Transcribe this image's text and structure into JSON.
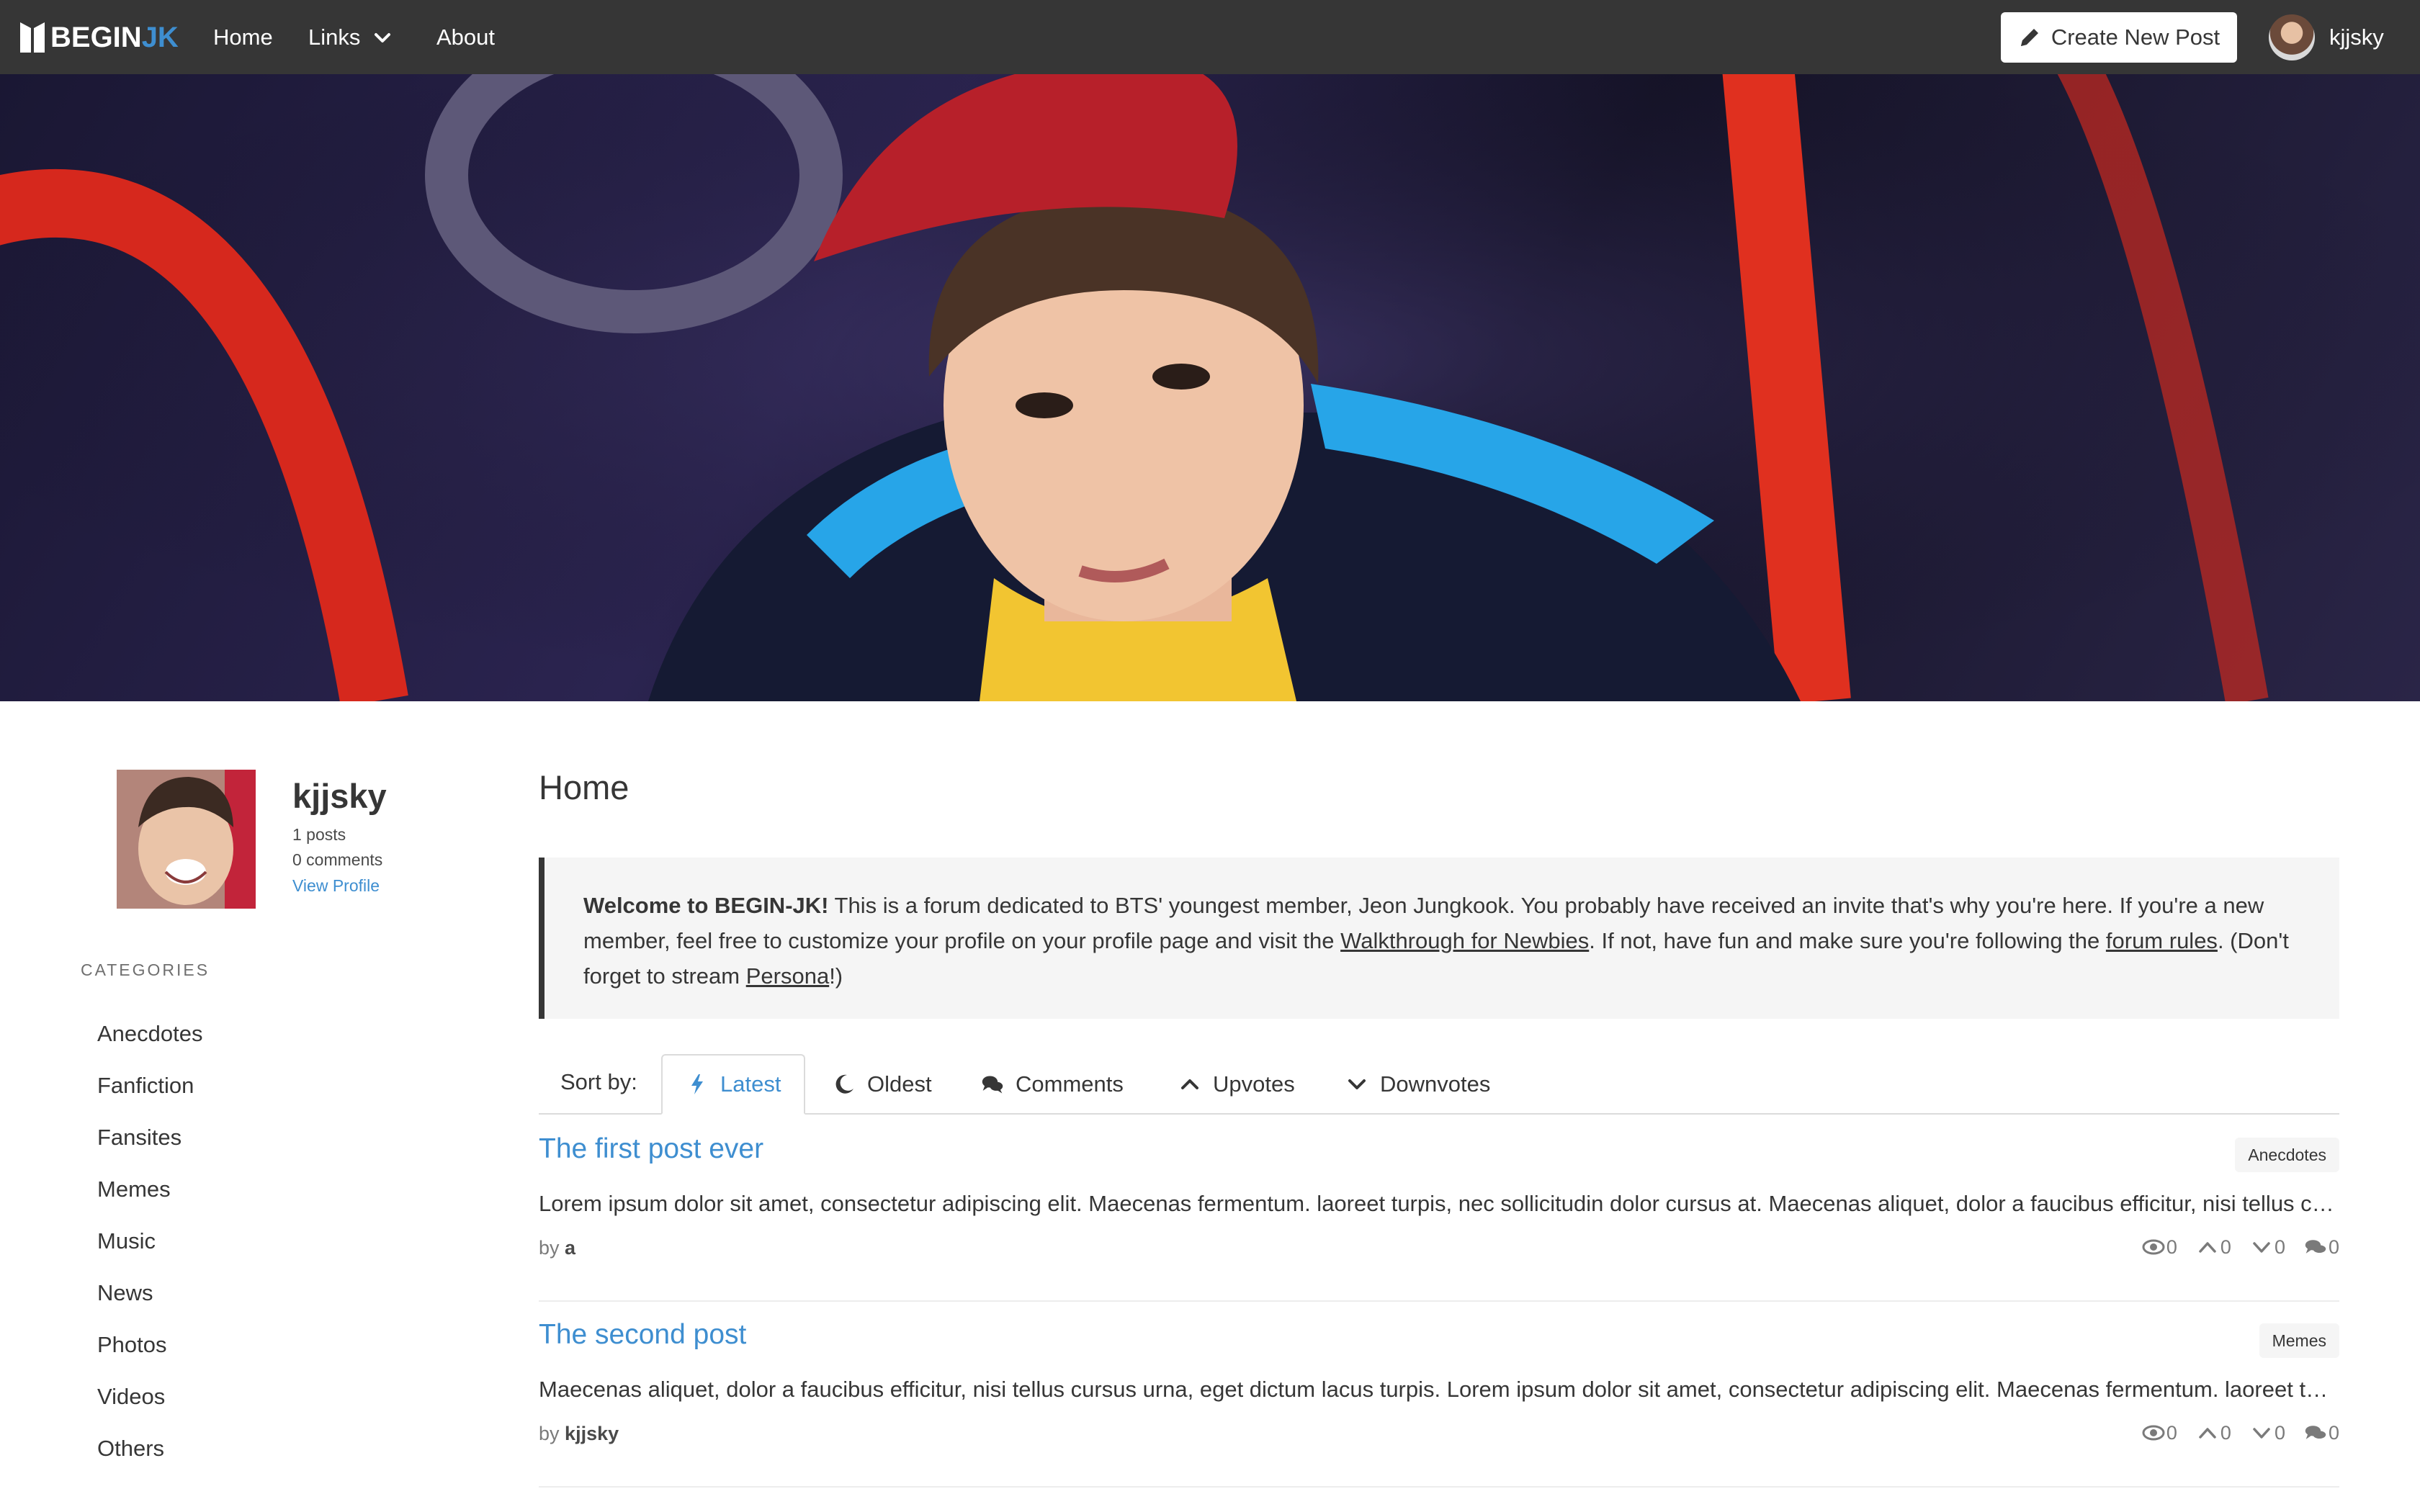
{
  "navbar": {
    "brand_begin": "BEGIN",
    "brand_jk": "JK",
    "home": "Home",
    "links": "Links",
    "about": "About",
    "create_post": "Create New Post",
    "username": "kjjsky"
  },
  "hero": {
    "icon": "hero-banner-image"
  },
  "profile": {
    "name": "kjjsky",
    "posts": "1 posts",
    "comments": "0 comments",
    "view_profile": "View Profile"
  },
  "sidebar": {
    "categories_label": "CATEGORIES",
    "categories": [
      "Anecdotes",
      "Fanfiction",
      "Fansites",
      "Memes",
      "Music",
      "News",
      "Photos",
      "Videos",
      "Others"
    ]
  },
  "main": {
    "title": "Home",
    "notice": {
      "bold": "Welcome to BEGIN-JK!",
      "text1": " This is a forum dedicated to BTS' youngest member, Jeon Jungkook. You probably have received an invite that's why you're here. If you're a new member, feel free to customize your profile on your profile page and visit the ",
      "link1": "Walkthrough for Newbies",
      "text2": ". If not, have fun and make sure you're following the ",
      "link2": "forum rules",
      "text3": ". (Don't forget to stream ",
      "link3": "Persona",
      "text4": "!)"
    },
    "sort": {
      "label": "Sort by:",
      "latest": "Latest",
      "oldest": "Oldest",
      "comments": "Comments",
      "upvotes": "Upvotes",
      "downvotes": "Downvotes"
    },
    "posts": [
      {
        "title": "The first post ever",
        "tag": "Anecdotes",
        "excerpt": "Lorem ipsum dolor sit amet, consectetur adipiscing elit. Maecenas fermentum. laoreet turpis, nec sollicitudin dolor cursus at. Maecenas aliquet, dolor a faucibus efficitur, nisi tellus cursus urna, eget dictum lacus turpis.",
        "by": "by",
        "author": "a",
        "views": "0",
        "upvotes": "0",
        "downvotes": "0",
        "comments": "0"
      },
      {
        "title": "The second post",
        "tag": "Memes",
        "excerpt": "Maecenas aliquet, dolor a faucibus efficitur, nisi tellus cursus urna, eget dictum lacus turpis. Lorem ipsum dolor sit amet, consectetur adipiscing elit. Maecenas fermentum. laoreet turpis, nec sollicitudin dolor cursus at.",
        "by": "by",
        "author": "kjjsky",
        "views": "0",
        "upvotes": "0",
        "downvotes": "0",
        "comments": "0"
      }
    ]
  },
  "colors": {
    "navbar": "#363636",
    "accent": "#3e8ed0",
    "text": "#363636",
    "notice_bg": "#f5f5f5"
  }
}
